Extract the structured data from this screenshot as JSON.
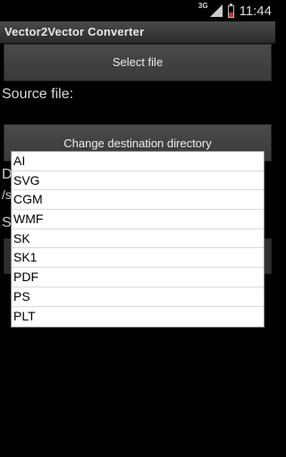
{
  "status_bar": {
    "network": "3G",
    "time": "11:44"
  },
  "app": {
    "title": "Vector2Vector Converter"
  },
  "main": {
    "select_file_label": "Select file",
    "source_file_label": "Source file:",
    "change_dest_label": "Change destination directory",
    "partial_d": "D",
    "partial_s": "/s",
    "partial_s2": "S"
  },
  "format_menu": {
    "items": [
      "AI",
      "SVG",
      "CGM",
      "WMF",
      "SK",
      "SK1",
      "PDF",
      "PS",
      "PLT"
    ]
  }
}
